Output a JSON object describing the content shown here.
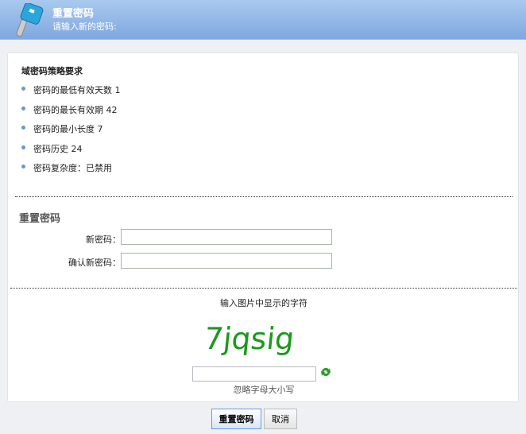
{
  "header": {
    "title": "重置密码",
    "subtitle": "请输入新的密码:"
  },
  "policy": {
    "title": "域密码策略要求",
    "items": [
      "密码的最低有效天数 1",
      "密码的最长有效期 42",
      "密码的最小长度 7",
      "密码历史 24",
      "密码复杂度：已禁用"
    ]
  },
  "reset": {
    "title": "重置密码",
    "new_label": "新密码：",
    "confirm_label": "确认新密码：",
    "new_value": "",
    "confirm_value": ""
  },
  "captcha": {
    "label": "输入图片中显示的字符",
    "image_text": "7jqsig",
    "value": "",
    "hint": "忽略字母大小写"
  },
  "buttons": {
    "submit": "重置密码",
    "cancel": "取消"
  }
}
